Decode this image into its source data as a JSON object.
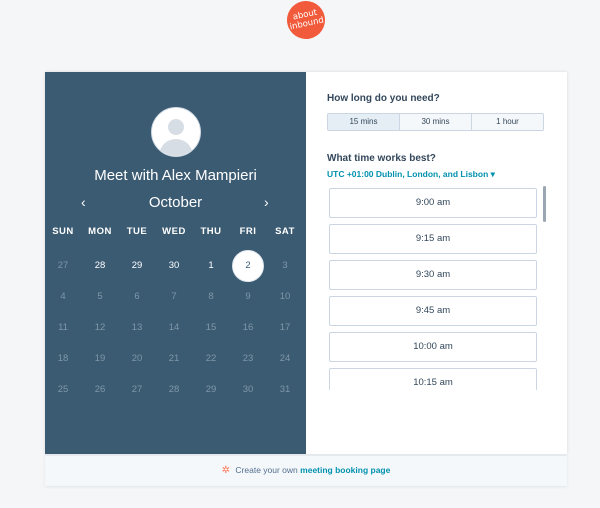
{
  "logo": {
    "line1": "about",
    "line2": "inbound",
    "color": "#f15a3a"
  },
  "organizer": {
    "title": "Meet with Alex Mampieri"
  },
  "calendar": {
    "month": "October",
    "prev_icon": "‹",
    "next_icon": "›",
    "weekdays": [
      "SUN",
      "MON",
      "TUE",
      "WED",
      "THU",
      "FRI",
      "SAT"
    ],
    "weeks": [
      [
        {
          "d": "27",
          "s": "off"
        },
        {
          "d": "28",
          "s": "avail"
        },
        {
          "d": "29",
          "s": "avail"
        },
        {
          "d": "30",
          "s": "avail"
        },
        {
          "d": "1",
          "s": "avail"
        },
        {
          "d": "2",
          "s": "selected"
        },
        {
          "d": "3",
          "s": "off"
        }
      ],
      [
        {
          "d": "4",
          "s": "off"
        },
        {
          "d": "5",
          "s": "off"
        },
        {
          "d": "6",
          "s": "off"
        },
        {
          "d": "7",
          "s": "off"
        },
        {
          "d": "8",
          "s": "off"
        },
        {
          "d": "9",
          "s": "off"
        },
        {
          "d": "10",
          "s": "off"
        }
      ],
      [
        {
          "d": "11",
          "s": "off"
        },
        {
          "d": "12",
          "s": "off"
        },
        {
          "d": "13",
          "s": "off"
        },
        {
          "d": "14",
          "s": "off"
        },
        {
          "d": "15",
          "s": "off"
        },
        {
          "d": "16",
          "s": "off"
        },
        {
          "d": "17",
          "s": "off"
        }
      ],
      [
        {
          "d": "18",
          "s": "off"
        },
        {
          "d": "19",
          "s": "off"
        },
        {
          "d": "20",
          "s": "off"
        },
        {
          "d": "21",
          "s": "off"
        },
        {
          "d": "22",
          "s": "off"
        },
        {
          "d": "23",
          "s": "off"
        },
        {
          "d": "24",
          "s": "off"
        }
      ],
      [
        {
          "d": "25",
          "s": "off"
        },
        {
          "d": "26",
          "s": "off"
        },
        {
          "d": "27",
          "s": "off"
        },
        {
          "d": "28",
          "s": "off"
        },
        {
          "d": "29",
          "s": "off"
        },
        {
          "d": "30",
          "s": "off"
        },
        {
          "d": "31",
          "s": "off"
        }
      ]
    ]
  },
  "booking": {
    "duration_question": "How long do you need?",
    "durations": [
      "15 mins",
      "30 mins",
      "1 hour"
    ],
    "selected_duration": "15 mins",
    "time_question": "What time works best?",
    "timezone": "UTC +01:00 Dublin, London, and Lisbon",
    "timezone_icon": "▾",
    "slots": [
      "9:00 am",
      "9:15 am",
      "9:30 am",
      "9:45 am",
      "10:00 am",
      "10:15 am"
    ]
  },
  "footer": {
    "icon": "✲",
    "text": "Create your own",
    "link": "meeting booking page"
  }
}
